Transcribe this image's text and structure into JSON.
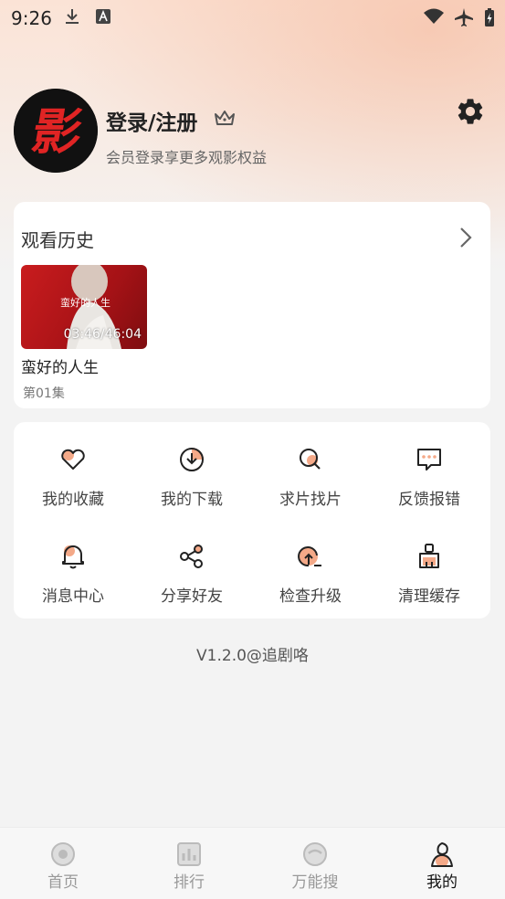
{
  "status_bar": {
    "time": "9:26"
  },
  "profile": {
    "name": "登录/注册",
    "subtitle": "会员登录享更多观影权益",
    "avatar_glyph": "影"
  },
  "history": {
    "title": "观看历史",
    "items": [
      {
        "title": "蛮好的人生",
        "episode": "第01集",
        "progress": "03:46/46:04",
        "poster_text": "蛮好的人生"
      }
    ]
  },
  "menu": {
    "items": [
      {
        "label": "我的收藏",
        "icon": "heart-icon"
      },
      {
        "label": "我的下载",
        "icon": "download-icon"
      },
      {
        "label": "求片找片",
        "icon": "search-film-icon"
      },
      {
        "label": "反馈报错",
        "icon": "feedback-icon"
      },
      {
        "label": "消息中心",
        "icon": "bell-icon"
      },
      {
        "label": "分享好友",
        "icon": "share-icon"
      },
      {
        "label": "检查升级",
        "icon": "upgrade-icon"
      },
      {
        "label": "清理缓存",
        "icon": "brush-icon"
      }
    ]
  },
  "version": "V1.2.0@追剧咯",
  "bottom_nav": {
    "items": [
      {
        "label": "首页",
        "icon": "home-icon"
      },
      {
        "label": "排行",
        "icon": "ranking-icon"
      },
      {
        "label": "万能搜",
        "icon": "search-icon"
      },
      {
        "label": "我的",
        "icon": "profile-icon"
      }
    ],
    "active_index": 3
  },
  "colors": {
    "accent": "#f4a988",
    "background": "#f3f3f3",
    "card": "#ffffff"
  }
}
